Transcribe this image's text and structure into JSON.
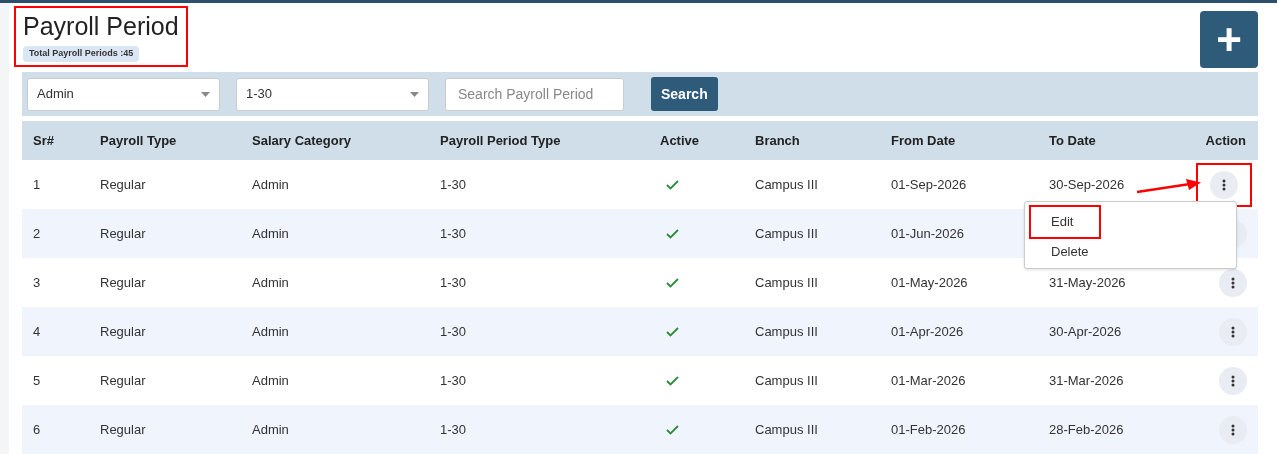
{
  "header": {
    "title": "Payroll Period",
    "total_badge": "Total Payroll Periods :45",
    "highlighted": true
  },
  "add_button": {
    "label": "+"
  },
  "filters": {
    "category_select": "Admin",
    "period_select": "1-30",
    "search": {
      "placeholder": "Search Payroll Period"
    },
    "search_button": "Search"
  },
  "table": {
    "columns": [
      "Sr#",
      "Payroll Type",
      "Salary Category",
      "Payroll Period Type",
      "Active",
      "Branch",
      "From Date",
      "To Date",
      "Action"
    ],
    "rows": [
      {
        "sr": "1",
        "payroll_type": "Regular",
        "salary_category": "Admin",
        "period_type": "1-30",
        "active": true,
        "branch": "Campus III",
        "from_date": "01-Sep-2026",
        "to_date": "30-Sep-2026",
        "action_highlighted": true
      },
      {
        "sr": "2",
        "payroll_type": "Regular",
        "salary_category": "Admin",
        "period_type": "1-30",
        "active": true,
        "branch": "Campus III",
        "from_date": "01-Jun-2026",
        "action_highlighted": false
      },
      {
        "sr": "3",
        "payroll_type": "Regular",
        "salary_category": "Admin",
        "period_type": "1-30",
        "active": true,
        "branch": "Campus III",
        "from_date": "01-May-2026",
        "to_date": "31-May-2026",
        "action_highlighted": false
      },
      {
        "sr": "4",
        "payroll_type": "Regular",
        "salary_category": "Admin",
        "period_type": "1-30",
        "active": true,
        "branch": "Campus III",
        "from_date": "01-Apr-2026",
        "to_date": "30-Apr-2026",
        "action_highlighted": false
      },
      {
        "sr": "5",
        "payroll_type": "Regular",
        "salary_category": "Admin",
        "period_type": "1-30",
        "active": true,
        "branch": "Campus III",
        "from_date": "01-Mar-2026",
        "to_date": "31-Mar-2026",
        "action_highlighted": false
      },
      {
        "sr": "6",
        "payroll_type": "Regular",
        "salary_category": "Admin",
        "period_type": "1-30",
        "active": true,
        "branch": "Campus III",
        "from_date": "01-Feb-2026",
        "to_date": "28-Feb-2026",
        "action_highlighted": false
      }
    ]
  },
  "action_menu": {
    "items": [
      {
        "label": "Edit",
        "highlighted": true
      },
      {
        "label": "Delete",
        "highlighted": false
      }
    ]
  },
  "annotation_arrow": true
}
